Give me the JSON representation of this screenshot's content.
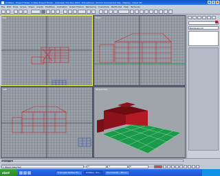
{
  "window": {
    "title": "Untitled - Project Folder: C:\\Max Project Folder - Autodesk 3ds Max 2009 - Educational - Not for Commercial Use - Display : Direct 3D"
  },
  "menu": [
    "File",
    "Edit",
    "Tools",
    "Group",
    "Views",
    "Create",
    "Modifiers",
    "Animation",
    "Graph Editors",
    "Rendering",
    "Customize",
    "MAXScript",
    "Help",
    "Tentacles"
  ],
  "viewports": {
    "top": "Top",
    "front": "Front",
    "left": "Left",
    "perspective": "Perspective"
  },
  "command_panel": {
    "field1": "",
    "field2": "Rectangle 10"
  },
  "timeline": {
    "frame": "0 / 100"
  },
  "status": {
    "text": "1 Object Selected",
    "x_label": "X:",
    "y_label": "Y:",
    "z_label": "Z:"
  },
  "taskbar": {
    "start_label": "start",
    "tasks": [
      "3 Google Toolbar Ex...",
      "Untitled - Pro...",
      "Document1 - Micro..."
    ]
  },
  "colors": {
    "model_wire": "#c8202c",
    "grass": "#1b9a4a",
    "glass_blue": "#3a4fb5",
    "house_red": "#a0141e"
  }
}
